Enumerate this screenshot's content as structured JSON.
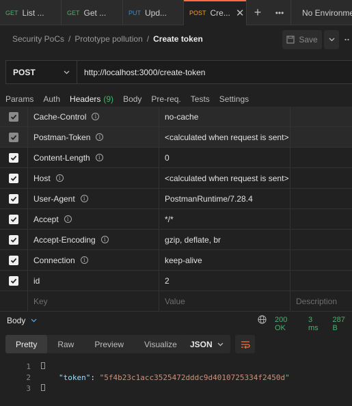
{
  "tabs": [
    {
      "method": "GET",
      "method_color": "#46b46c",
      "label": "List ..."
    },
    {
      "method": "GET",
      "method_color": "#46b46c",
      "label": "Get ..."
    },
    {
      "method": "PUT",
      "method_color": "#3c8bd4",
      "label": "Upd..."
    },
    {
      "method": "POST",
      "method_color": "#e8a43a",
      "label": "Cre..."
    }
  ],
  "environment": "No Environment",
  "breadcrumb": [
    "Security PoCs",
    "Prototype pollution",
    "Create token"
  ],
  "save_label": "Save",
  "request": {
    "method": "POST",
    "url": "http://localhost:3000/create-token"
  },
  "request_tabs": [
    {
      "label": "Params"
    },
    {
      "label": "Auth"
    },
    {
      "label": "Headers",
      "count": "(9)"
    },
    {
      "label": "Body"
    },
    {
      "label": "Pre-req."
    },
    {
      "label": "Tests"
    },
    {
      "label": "Settings"
    }
  ],
  "headers": [
    {
      "key": "Cache-Control",
      "value": "no-cache",
      "enabled": true,
      "auto": true
    },
    {
      "key": "Postman-Token",
      "value": "<calculated when request is sent>",
      "enabled": true,
      "auto": true
    },
    {
      "key": "Content-Length",
      "value": "0",
      "enabled": true,
      "auto": false
    },
    {
      "key": "Host",
      "value": "<calculated when request is sent>",
      "enabled": true,
      "auto": false
    },
    {
      "key": "User-Agent",
      "value": "PostmanRuntime/7.28.4",
      "enabled": true,
      "auto": false
    },
    {
      "key": "Accept",
      "value": "*/*",
      "enabled": true,
      "auto": false
    },
    {
      "key": "Accept-Encoding",
      "value": "gzip, deflate, br",
      "enabled": true,
      "auto": false
    },
    {
      "key": "Connection",
      "value": "keep-alive",
      "enabled": true,
      "auto": false
    },
    {
      "key": "id",
      "value": "2",
      "enabled": true,
      "auto": false,
      "no_info": true
    }
  ],
  "header_placeholders": {
    "key": "Key",
    "value": "Value",
    "description": "Description"
  },
  "response": {
    "title": "Body",
    "status": "200 OK",
    "time": "3 ms",
    "size": "287 B",
    "views": [
      "Pretty",
      "Raw",
      "Preview",
      "Visualize"
    ],
    "format": "JSON",
    "line_numbers": [
      "1",
      "2",
      "3"
    ],
    "token_key": "\"token\"",
    "token_value": "\"5f4b23c1acc3525472dddc9d4010725334f2450d\""
  },
  "colors": {
    "accent": "#ff6c37",
    "success": "#46b46c"
  }
}
